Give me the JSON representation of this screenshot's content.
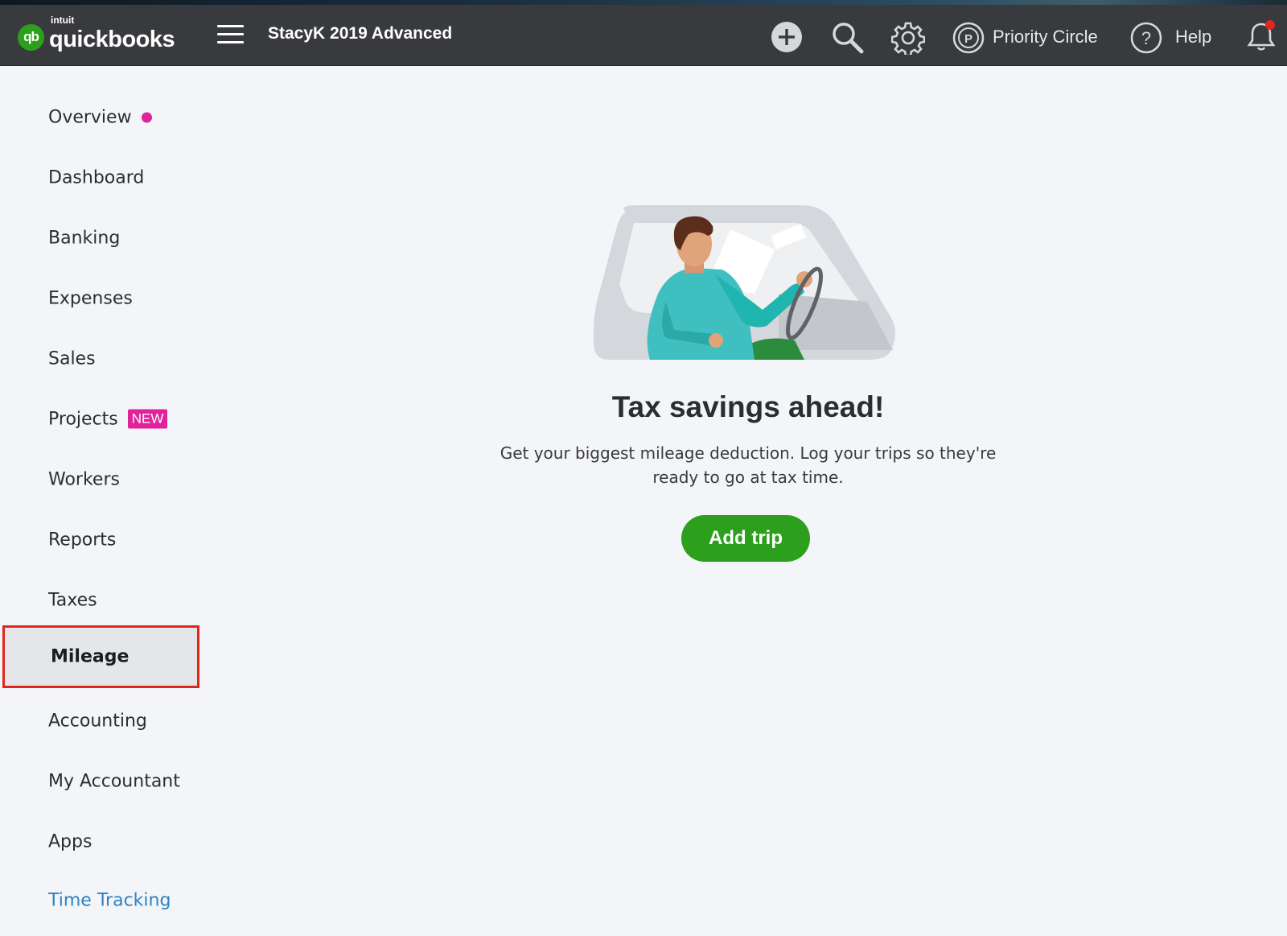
{
  "header": {
    "logo_intuit": "intuit",
    "logo_text": "quickbooks",
    "logo_mark": "qb",
    "company": "StacyK 2019 Advanced",
    "priority_circle": "Priority Circle",
    "help": "Help",
    "icons": [
      "menu-icon",
      "plus-circle-icon",
      "search-icon",
      "gear-icon",
      "priority-circle-icon",
      "help-icon",
      "bell-icon"
    ]
  },
  "nav": {
    "items": [
      {
        "label": "Overview"
      },
      {
        "label": "Dashboard"
      },
      {
        "label": "Banking"
      },
      {
        "label": "Expenses"
      },
      {
        "label": "Sales"
      },
      {
        "label": "Projects",
        "badge": "NEW"
      },
      {
        "label": "Workers"
      },
      {
        "label": "Reports"
      },
      {
        "label": "Taxes"
      },
      {
        "label": "Mileage",
        "active": true
      },
      {
        "label": "Accounting"
      },
      {
        "label": "My Accountant"
      },
      {
        "label": "Apps"
      },
      {
        "label": "Time Tracking"
      }
    ]
  },
  "main": {
    "title": "Tax savings ahead!",
    "description": "Get your biggest mileage deduction. Log your trips so they're ready to go at tax time.",
    "add_trip": "Add trip"
  },
  "colors": {
    "topbar": "#393a3d",
    "brand_green": "#2ca01c",
    "badge_pink": "#e0229b",
    "highlight_red": "#e1261c",
    "link_blue": "#2e82c3"
  }
}
